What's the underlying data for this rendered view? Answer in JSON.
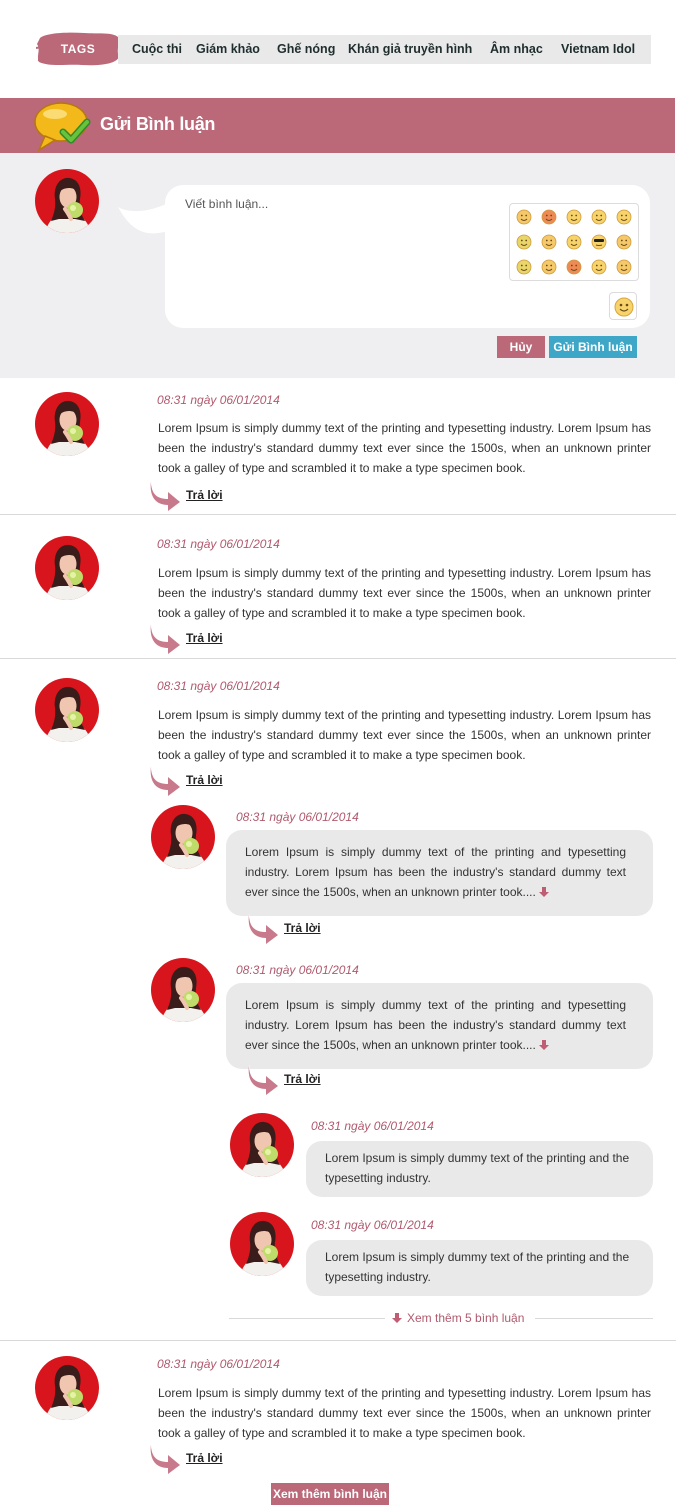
{
  "tags": {
    "label": "TAGS",
    "items": [
      {
        "label": "Cuộc thi"
      },
      {
        "label": "Giám khảo"
      },
      {
        "label": "Ghế nóng"
      },
      {
        "label": "Khán giả truyền hình"
      },
      {
        "label": "Âm nhạc"
      },
      {
        "label": "Vietnam Idol"
      }
    ]
  },
  "send": {
    "title": "Gửi Bình luận",
    "placeholder": "Viết bình luận...",
    "cancel_label": "Hủy",
    "submit_label": "Gửi Bình luận"
  },
  "comments": [
    {
      "time": "08:31 ngày 06/01/2014",
      "text": "Lorem Ipsum is simply dummy text of the printing and typesetting industry. Lorem Ipsum has been the industry's standard dummy text ever since the 1500s, when an unknown printer took a galley of type and scrambled it to make a type specimen book.",
      "reply": "Trả lời"
    },
    {
      "time": "08:31 ngày 06/01/2014",
      "text": "Lorem Ipsum is simply dummy text of the printing and typesetting industry. Lorem Ipsum has been the industry's standard dummy text ever since the 1500s, when an unknown printer took a galley of type and scrambled it to make a type specimen book.",
      "reply": "Trả lời"
    },
    {
      "time": "08:31 ngày 06/01/2014",
      "text": "Lorem Ipsum is simply dummy text of the printing and typesetting industry. Lorem Ipsum has been the industry's standard dummy text ever since the 1500s, when an unknown printer took a galley of type and scrambled it to make a type specimen book.",
      "reply": "Trả lời"
    },
    {
      "time": "08:31 ngày 06/01/2014",
      "text": "Lorem Ipsum is simply dummy text of the printing and typesetting industry. Lorem Ipsum has been the industry's standard dummy text ever since the 1500s, when an unknown printer took a galley of type and scrambled it to make a type specimen book.",
      "reply": "Trả lời"
    }
  ],
  "replies_l1": [
    {
      "time": "08:31 ngày 06/01/2014",
      "text": "Lorem Ipsum is simply dummy text of the printing and typesetting industry. Lorem Ipsum has been the industry's standard dummy text ever since the 1500s, when an unknown printer took....",
      "reply": "Trả lời"
    },
    {
      "time": "08:31 ngày 06/01/2014",
      "text": "Lorem Ipsum is simply dummy text of the printing and typesetting industry. Lorem Ipsum has been the industry's standard dummy text ever since the 1500s, when an unknown printer took....",
      "reply": "Trả lời"
    }
  ],
  "replies_l2": [
    {
      "time": "08:31 ngày 06/01/2014",
      "text": "Lorem Ipsum is simply dummy text of the printing and the typesetting industry."
    },
    {
      "time": "08:31 ngày 06/01/2014",
      "text": "Lorem Ipsum is simply dummy text of the printing and the typesetting industry."
    }
  ],
  "more_replies_label": "Xem thêm 5 bình luận",
  "load_more_label": "Xem thêm bình luận",
  "colors": {
    "accent": "#bb6879",
    "send_button": "#3ea7c8",
    "time": "#b05a6e"
  }
}
